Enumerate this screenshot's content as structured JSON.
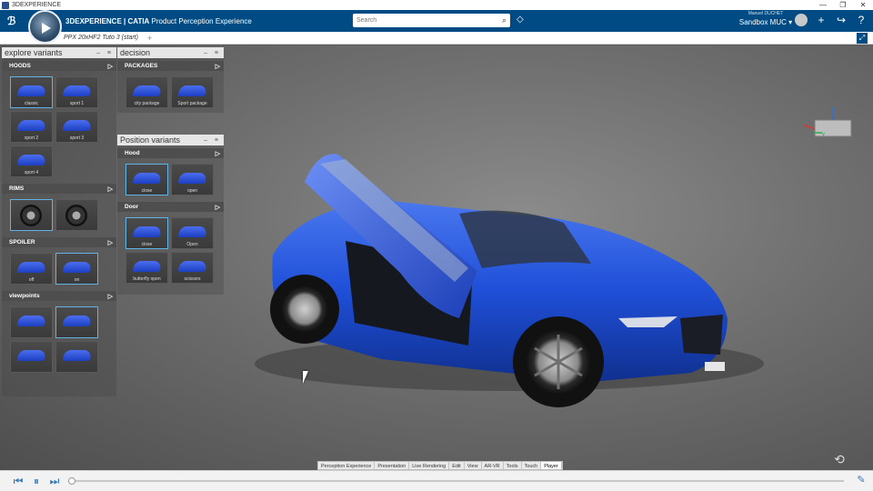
{
  "window": {
    "title": "3DEXPERIENCE",
    "controls": [
      "—",
      "❐",
      "✕"
    ]
  },
  "topbar": {
    "brand_strong": "3DEXPERIENCE | CATIA",
    "brand_rest": " Product Perception Experience",
    "search_placeholder": "Search",
    "user_name": "Manuel DUCHET",
    "tenant": "Sandbox MUC ▾"
  },
  "tabbar": {
    "tab_label": "PPX 20xHF2 Tuto 3 (start)",
    "add_label": "+"
  },
  "panels": {
    "explore": {
      "title": "explore variants",
      "groups": [
        {
          "title": "HOODS",
          "items": [
            "classic",
            "sport 1",
            "sport 2",
            "sport 3",
            "sport 4"
          ],
          "selected": 0,
          "kind": "hood"
        },
        {
          "title": "RIMS",
          "items": [
            "",
            ""
          ],
          "selected": 0,
          "kind": "rim"
        },
        {
          "title": "SPOILER",
          "items": [
            "off",
            "on"
          ],
          "selected": 1,
          "kind": "spoiler"
        },
        {
          "title": "viewpoints",
          "items": [
            "",
            "",
            "",
            ""
          ],
          "selected": 1,
          "kind": "view"
        }
      ]
    },
    "decision": {
      "title": "decision",
      "groups": [
        {
          "title": "PACKAGES",
          "items": [
            "city package",
            "Sport package"
          ],
          "selected": -1,
          "kind": "car"
        }
      ]
    },
    "position": {
      "title": "Position variants",
      "groups": [
        {
          "title": "Hood",
          "items": [
            "close",
            "open"
          ],
          "selected": 0,
          "kind": "car"
        },
        {
          "title": "Door",
          "items": [
            "close",
            "Open",
            "butterfly open",
            "scissors"
          ],
          "selected": 0,
          "kind": "car"
        }
      ]
    }
  },
  "axis": {
    "x": "x",
    "y": "y",
    "z": "z"
  },
  "menu_tabs": [
    "Perception Experience",
    "Presentation",
    "Live Rendering",
    "Edit",
    "View",
    "AR-VR",
    "Tools",
    "Touch",
    "Player"
  ],
  "active_menu_tab": "Player",
  "player": {
    "progress": 0.0
  },
  "colors": {
    "brand_blue": "#004b83",
    "car_blue": "#1f4fd8",
    "selection": "#5fb3e6"
  }
}
